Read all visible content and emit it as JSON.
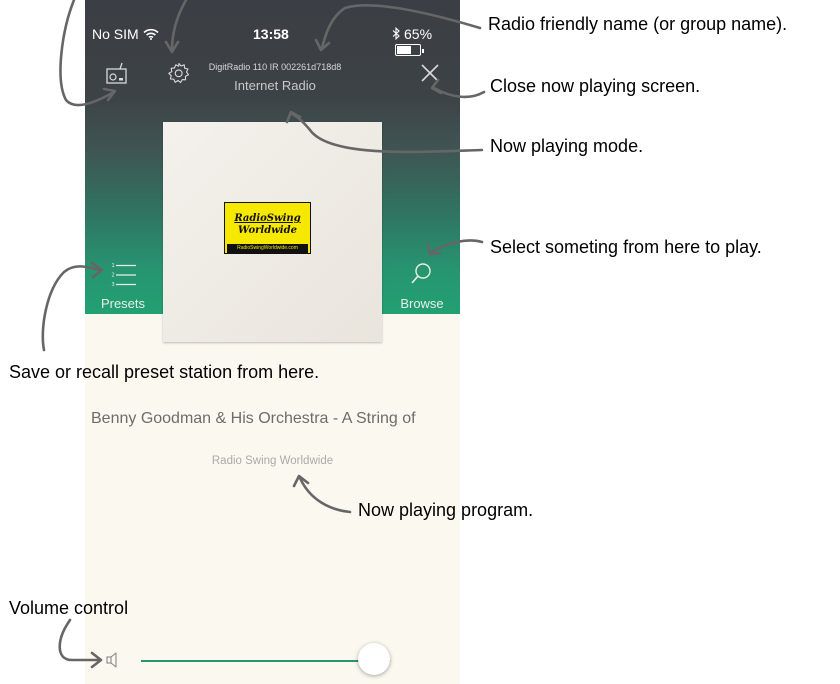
{
  "status_bar": {
    "carrier": "No SIM",
    "time": "13:58",
    "battery": "65%",
    "battery_level": 0.65
  },
  "header": {
    "radio_name": "DigitRadio 110 IR  002261d718d8",
    "mode": "Internet Radio"
  },
  "artwork": {
    "logo_line1": "RadioSwing",
    "logo_line2": "Worldwide",
    "logo_url": "RadioSwingWorldwide.com"
  },
  "nav": {
    "presets_label": "Presets",
    "browse_label": "Browse"
  },
  "now_playing": {
    "track": "Benny Goodman & His Orchestra - A String of",
    "program": "Radio Swing Worldwide"
  },
  "volume": {
    "level": 0.93
  },
  "annotations": {
    "radio_name": "Radio friendly name (or group name).",
    "close": "Close now playing screen.",
    "mode": "Now playing mode.",
    "browse": "Select someting from here to play.",
    "presets": "Save or recall preset station from here.",
    "program": "Now playing program.",
    "volume": "Volume control"
  },
  "colors": {
    "accent": "#27966f",
    "header_dark": "#3b3e44",
    "background": "#fbf9ef"
  },
  "icons": [
    "wifi-icon",
    "bluetooth-icon",
    "battery-icon",
    "radio-icon",
    "settings-icon",
    "close-icon",
    "presets-list-icon",
    "search-icon",
    "volume-icon"
  ]
}
